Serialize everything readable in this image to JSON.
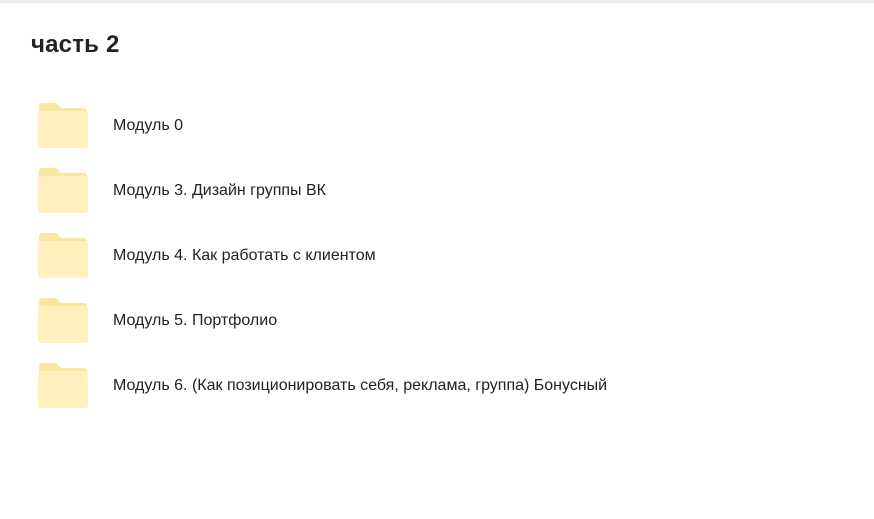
{
  "page": {
    "title": "часть 2"
  },
  "folders": [
    {
      "name": "Модуль 0",
      "icon": "folder-icon"
    },
    {
      "name": "Модуль 3. Дизайн группы ВК",
      "icon": "folder-icon"
    },
    {
      "name": "Модуль 4. Как работать с клиентом",
      "icon": "folder-icon"
    },
    {
      "name": "Модуль 5. Портфолио",
      "icon": "folder-icon"
    },
    {
      "name": "Модуль 6. (Как позиционировать себя, реклама, группа) Бонусный",
      "icon": "folder-icon"
    }
  ],
  "colors": {
    "folder_back": "#fbe6a0",
    "folder_front": "#fff0bd",
    "text": "#222222",
    "background": "#ffffff"
  }
}
